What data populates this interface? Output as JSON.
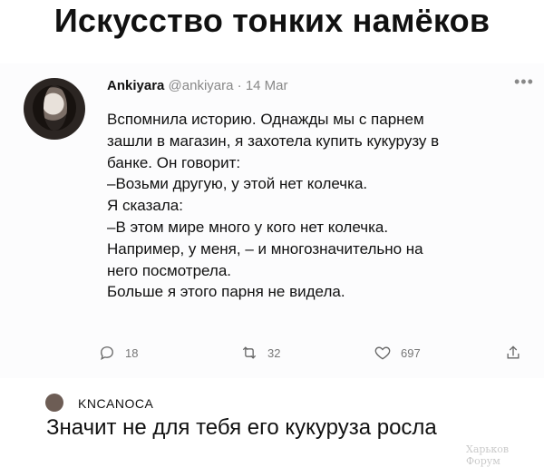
{
  "title": "Искусство тонких намёков",
  "tweet": {
    "author": "Ankiyara",
    "handle": "@ankiyara",
    "date": "· 14 Mar",
    "more_icon": "more-icon",
    "lines": [
      "Вспомнила историю. Однажды мы с парнем",
      "зашли в магазин, я захотела купить кукурузу в",
      "банке. Он говорит:",
      "–Возьми другую, у этой нет колечка.",
      "Я сказала:",
      "–В этом мире много у кого нет колечка.",
      "Например, у меня, – и многозначительно на",
      "него посмотрела.",
      "Больше я этого парня не видела."
    ],
    "actions": {
      "replies": "18",
      "retweets": "32",
      "likes": "697"
    }
  },
  "comment": {
    "user": "KNCANOCA",
    "text": "Значит не для тебя его кукуруза росла"
  },
  "watermark": "Харьков Форум"
}
